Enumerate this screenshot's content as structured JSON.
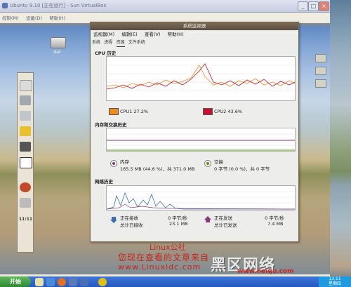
{
  "host": {
    "window_title": "Ubuntu 9.10 [正在运行] - Sun VirtualBox",
    "menu": [
      "控制(M)",
      "设备(D)",
      "帮助(H)"
    ],
    "taskbar": {
      "start_label": "开始",
      "clock_time": "13:11",
      "clock_day": "星期四"
    }
  },
  "guest": {
    "desktop_icon_label": "dat",
    "panel_clock": "11:11",
    "system_monitor": {
      "title": "系统监视器",
      "menu": [
        "监视器(M)",
        "编辑(E)",
        "查看(V)",
        "帮助(H)"
      ],
      "tabs": [
        "系统",
        "进程",
        "资源",
        "文件系统"
      ],
      "cpu": {
        "section_title": "CPU 历史",
        "cpu1_label": "CPU1 27.2%",
        "cpu2_label": "CPU2 43.6%",
        "cpu1_color": "#f08a1c",
        "cpu2_color": "#c8102e"
      },
      "mem": {
        "section_title": "内存和交换历史",
        "mem_label": "内存",
        "mem_value": "165.5 MB (44.6 %)，共 371.0 MB",
        "swap_label": "交换",
        "swap_value": "0 字节 (0.0 %)，共 0 字节",
        "mem_color": "#8a3a7a",
        "swap_color": "#4e9a06"
      },
      "net": {
        "section_title": "网络历史",
        "recv_label": "正在接收",
        "recv_rate": "0 字节/秒",
        "recv_total_label": "总计已接收",
        "recv_total": "23.1 MB",
        "send_label": "正在发送",
        "send_rate": "0 字节/秒",
        "send_total_label": "总计已发送",
        "send_total": "7.4 MB"
      },
      "y_ticks": [
        "100 %",
        "80 %",
        "60 %",
        "40 %",
        "20 %",
        "0 %"
      ],
      "x_ticks": [
        "60",
        "50",
        "40",
        "30",
        "20",
        "10",
        "0"
      ]
    }
  },
  "watermark": {
    "line1": "Linux公社",
    "line2": "您现在查看的文章来自",
    "line3": "www.Linuxidc.com",
    "logo": "黑区网络",
    "site": "www.heiqu.com"
  }
}
